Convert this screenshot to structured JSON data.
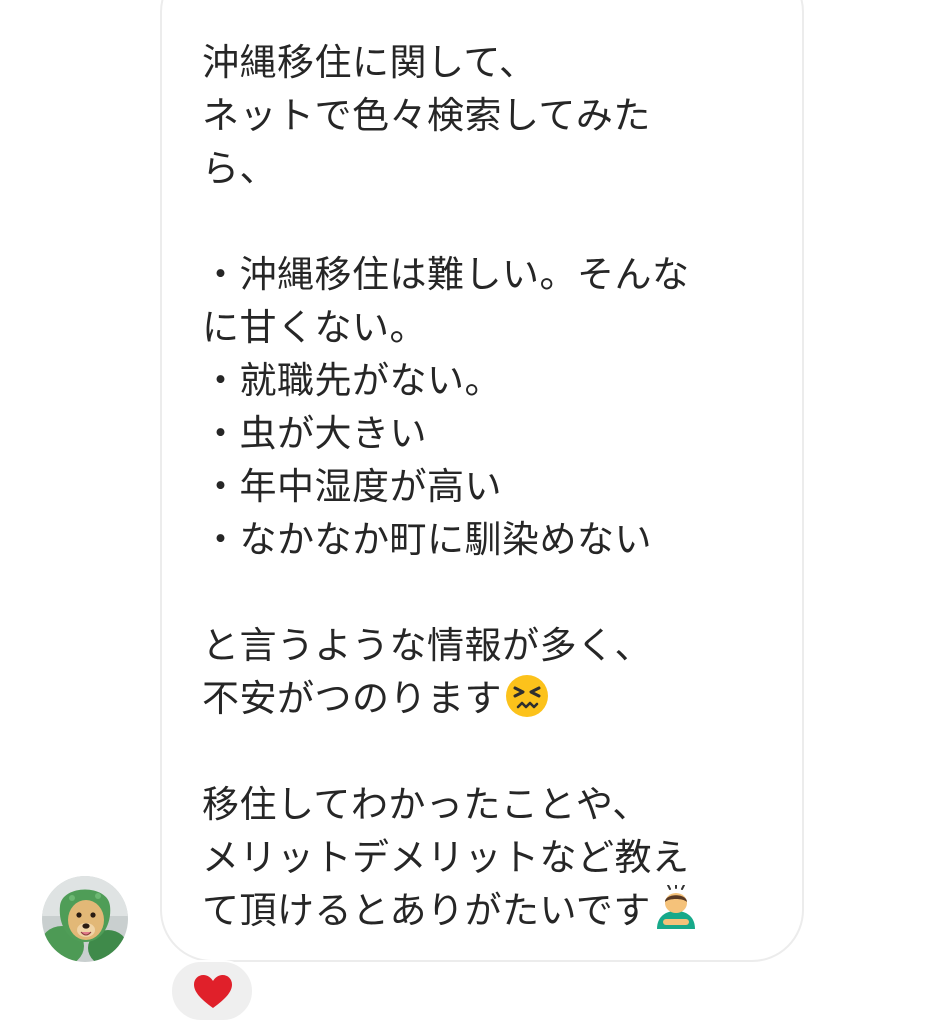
{
  "message": {
    "lines": [
      "沖縄移住に関して、",
      "ネットで色々検索してみた",
      "ら、",
      "",
      "・沖縄移住は難しい。そんな",
      "に甘くない。",
      "・就職先がない。",
      "・虫が大きい",
      "・年中湿度が高い",
      "・なかなか町に馴染めない",
      "",
      "と言うような情報が多く、",
      "不安がつのります",
      "",
      "移住してわかったことや、",
      "メリットデメリットなど教え",
      "て頂けるとありがたいです"
    ],
    "emoji_1": "persevering-face",
    "emoji_2": "person-bowing"
  },
  "sender": {
    "avatar": "golden-retriever-photo"
  },
  "reaction": {
    "icon": "red-heart",
    "color": "#e0202a"
  },
  "colors": {
    "text": "#262626",
    "bubble_border": "#ececec",
    "reaction_bg": "#efefef"
  }
}
